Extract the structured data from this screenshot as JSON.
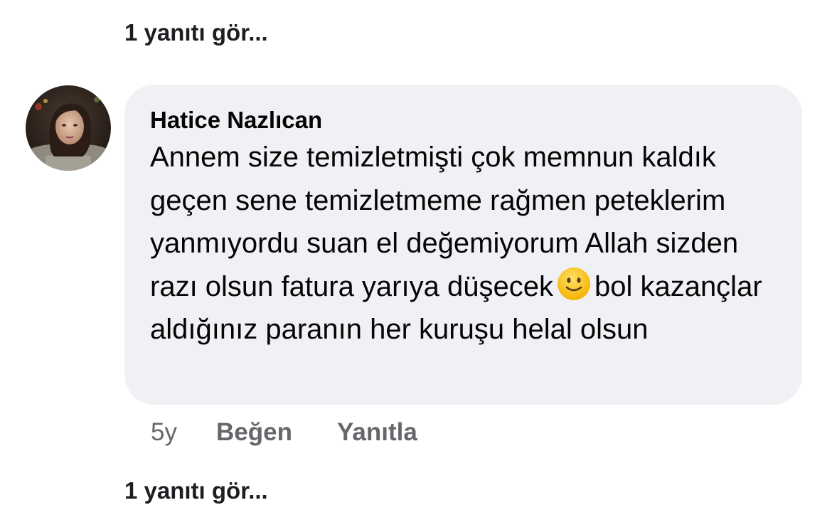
{
  "replies_top": {
    "label": "1 yanıtı gör..."
  },
  "comment": {
    "author": "Hatice Nazlıcan",
    "text_before_emoji": "Annem size temizletmişti çok memnun kaldık geçen sene temizletmeme rağmen peteklerim yanmıyordu suan el değemiyorum Allah sizden razı olsun fatura yarıya düşecek",
    "emoji": "slightly-smiling-face-emoji",
    "text_after_emoji": "bol kazançlar aldığınız paranın her kuruşu helal olsun",
    "time": "5y",
    "like_label": "Beğen",
    "reply_label": "Yanıtla"
  },
  "replies_bottom": {
    "label": "1 yanıtı gör..."
  },
  "colors": {
    "bubble": "#f0f1f4",
    "meta_text": "#65676b",
    "text": "#050505",
    "emoji_face": "#fbc02d"
  }
}
